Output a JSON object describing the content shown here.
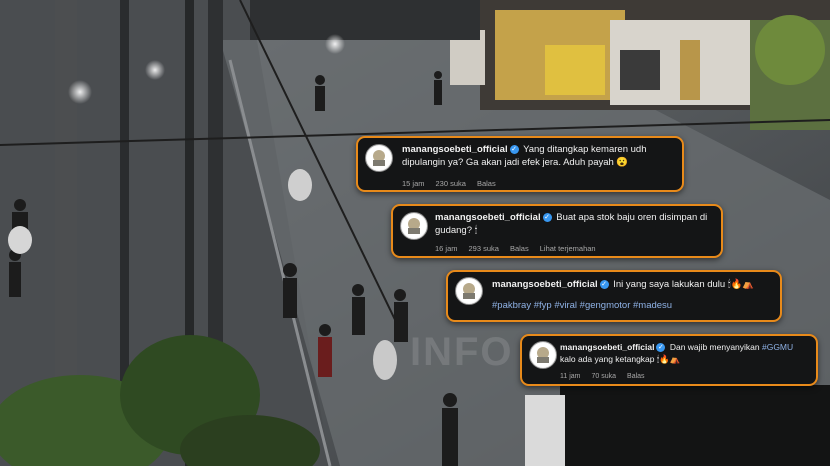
{
  "comments": [
    {
      "username": "manangsoebeti_official",
      "text": "Yang ditangkap kemaren udh dipulangin ya? Ga akan jadi efek jera. Aduh payah 😮",
      "time": "15 jam",
      "likes": "230 suka",
      "reply": "Balas"
    },
    {
      "username": "manangsoebeti_official",
      "text": "Buat apa stok baju oren disimpan di gudang? 🕯",
      "time": "16 jam",
      "likes": "293 suka",
      "reply": "Balas",
      "translate": "Lihat terjemahan"
    },
    {
      "username": "manangsoebeti_official",
      "text": "Ini yang saya lakukan dulu 🕯🔥⛺",
      "hashtags": "#pakbray #fyp #viral #gengmotor #madesu"
    },
    {
      "username": "manangsoebeti_official",
      "text_start": "Dan wajib menyanyikan ",
      "hashtag": "#GGMU",
      "text_end": "kalo ada yang ketangkap 🕯🔥⛺",
      "time": "11 jam",
      "likes": "70 suka",
      "reply": "Balas"
    }
  ],
  "watermark": "INFO"
}
